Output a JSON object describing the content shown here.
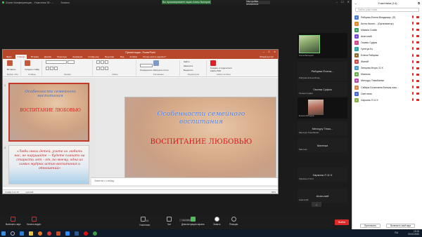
{
  "top": {
    "app_title": "Zoom Конференция - Участник ID: ...",
    "record_status": "Запись",
    "banner": "Вы просматриваете экран Агаты Валерия",
    "view_options": "Настройки просмотра",
    "window_controls": [
      "–",
      "☐",
      "✕"
    ]
  },
  "powerpoint": {
    "title": "Презентация - PowerPoint",
    "tabs": [
      "Файл",
      "Главная",
      "Вставка",
      "Дизайн",
      "Переходы",
      "Анимация",
      "Слайд-шоу",
      "Рецензир.",
      "Вид",
      "Acrobat",
      "Что вы хотите сделать?"
    ],
    "active_tab": "Главная",
    "share_label": "Общий доступ",
    "ribbon_groups": [
      "Буфер обм.",
      "Слайды",
      "Шрифт",
      "Абзац",
      "Рисование",
      "Редактиров.",
      "Adobe Acrobat"
    ],
    "ribbon_buttons": [
      "Вставить",
      "Создать слайд",
      "Упорядочить",
      "Экспресс-стили",
      "Найти",
      "Заменить",
      "Выделить",
      "Создать и поделиться Adobe PDF"
    ],
    "slide1_title": "Особенности семейного воспитания",
    "slide1_subtitle": "ВОСПИТАНИЕ ЛЮБОВЬЮ",
    "slide2_quote": "«Люби своих детей, учите их любить нас, не нарушайте — будете плакать на старости лет – от, по-моему, одна из самых мудрых истин воспитания и отношений»",
    "thumb_numbers": [
      "1",
      "2"
    ],
    "notes_placeholder": "Заметки к слайду",
    "status_left": "Слайд 1 из 10",
    "status_lang": "русский",
    "status_zoom": "36%"
  },
  "gallery": {
    "tiles": [
      {
        "name": "",
        "sub": "Агата Валерия"
      },
      {
        "name": "Рябцева Елена...",
        "sub": "Рябцева Елена Влад..."
      },
      {
        "name": "Гачева Суфия",
        "sub": "Гачева Суфия"
      },
      {
        "name": "",
        "sub": "Елена Рябцева"
      },
      {
        "name": "Менсуру Темо...",
        "sub": "Менсуру Темобаева"
      },
      {
        "name": "Мантым",
        "sub": "Мантым"
      },
      {
        "name": "Харкина Л 11 К",
        "sub": "Харкина Л 11 К"
      },
      {
        "name": "Анатолий",
        "sub": "Анатолий"
      }
    ],
    "scroll_icon": "⌄"
  },
  "toolbar": {
    "buttons": [
      "Включить звук",
      "Начать видео",
      "Участники",
      "Чат",
      "Демонстрация экрана",
      "Запись",
      "Реакции"
    ],
    "participants_count": "14",
    "chat_note": "Чат (49+1)",
    "end_label": "Выйти"
  },
  "panel": {
    "title": "Участники (14)",
    "search_placeholder": "Найти участника",
    "participants": [
      {
        "initial": "Р",
        "name": "Рябцева Елена Владимир. (Я)",
        "color": "#4a7bd1"
      },
      {
        "initial": "А",
        "name": "Агата Калин... (Организатор)",
        "color": "#e08a2c"
      },
      {
        "initial": "M",
        "name": "Mikaela Goldie",
        "color": "#3a9c5b"
      },
      {
        "initial": "А",
        "name": "Анатолий",
        "color": "#7b4ac8"
      },
      {
        "initial": "Г",
        "name": "Гачева Суфия",
        "color": "#d14a8a"
      },
      {
        "initial": "Г",
        "name": "Гунегуа Кз",
        "color": "#2aa5a5"
      },
      {
        "initial": "Е",
        "name": "Елена Рябцева",
        "color": "#8a6a2c"
      },
      {
        "initial": "Ж",
        "name": "Жанай",
        "color": "#c84a4a"
      },
      {
        "initial": "З",
        "name": "Зинцова Игорь 11 К",
        "color": "#4a9cd1"
      },
      {
        "initial": "М",
        "name": "Мантым",
        "color": "#6ab04c"
      },
      {
        "initial": "М",
        "name": "Менсуру Темобаева",
        "color": "#b04ca8"
      },
      {
        "initial": "С",
        "name": "Сабира Болатовна Балшы наш...",
        "color": "#d18a4a"
      },
      {
        "initial": "С",
        "name": "Светлана",
        "color": "#4a6ad1"
      },
      {
        "initial": "Х",
        "name": "Харкина Л 11 К",
        "color": "#8ab04c"
      }
    ],
    "invite": "Пригласить",
    "unmute_me": "Включить свой звук"
  },
  "taskbar": {
    "icons": [
      "start-icon",
      "search-icon",
      "ie-icon",
      "explorer-icon",
      "firefox-icon",
      "yandex-icon",
      "powerpoint-icon",
      "zoom-icon",
      "word-icon",
      "opera-icon",
      "chrome-icon"
    ],
    "lang": "RU",
    "time": "19:15",
    "date": "20.03.2020"
  }
}
